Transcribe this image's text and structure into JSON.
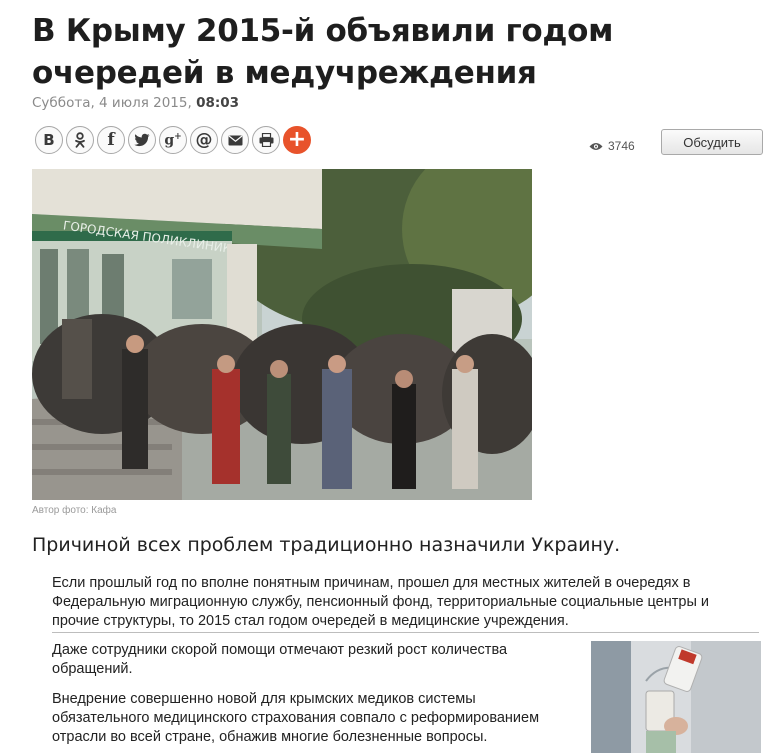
{
  "article": {
    "headline": "В Крыму 2015-й объявили годом очередей в медучреждения",
    "date": "Суббота, 4 июля 2015,",
    "time": "08:03"
  },
  "share_buttons": [
    {
      "icon": "vk-icon",
      "glyph": "B"
    },
    {
      "icon": "odnoklassniki-icon",
      "glyph": "ok"
    },
    {
      "icon": "facebook-icon",
      "glyph": "f"
    },
    {
      "icon": "twitter-icon",
      "glyph": "bird"
    },
    {
      "icon": "google-plus-icon",
      "glyph": "g+"
    },
    {
      "icon": "mailru-icon",
      "glyph": "@"
    },
    {
      "icon": "email-icon",
      "glyph": "envelope"
    },
    {
      "icon": "print-icon",
      "glyph": "printer"
    },
    {
      "icon": "more-share-icon",
      "glyph": "+"
    }
  ],
  "views": {
    "count": "3746",
    "icon": "eye-icon"
  },
  "discuss_button": {
    "label": "Обсудить"
  },
  "photo": {
    "credit": "Автор фото: Кафа",
    "sign_text": "ГОРОДСКАЯ ПОЛИКЛИНИКА"
  },
  "lead": "Причиной всех проблем традиционно назначили Украину.",
  "paragraphs": [
    "Если прошлый год по вполне понятным причинам, прошел для местных жителей в очередях в Федеральную миграционную службу, пенсионный фонд, территориальные социальные центры и прочие структуры, то 2015 стал годом очередей в медицинские учреждения.",
    "Даже сотрудники скорой помощи отмечают резкий рост количества обращений.",
    "Внедрение совершенно новой для крымских медиков системы обязательного медицинского страхования совпало с реформированием отрасли во всей стране, обнажив многие болезненные вопросы."
  ],
  "colors": {
    "accent_plus": "#e8532b",
    "headline": "#1e1e1e",
    "meta_gray": "#8a8a8a"
  }
}
